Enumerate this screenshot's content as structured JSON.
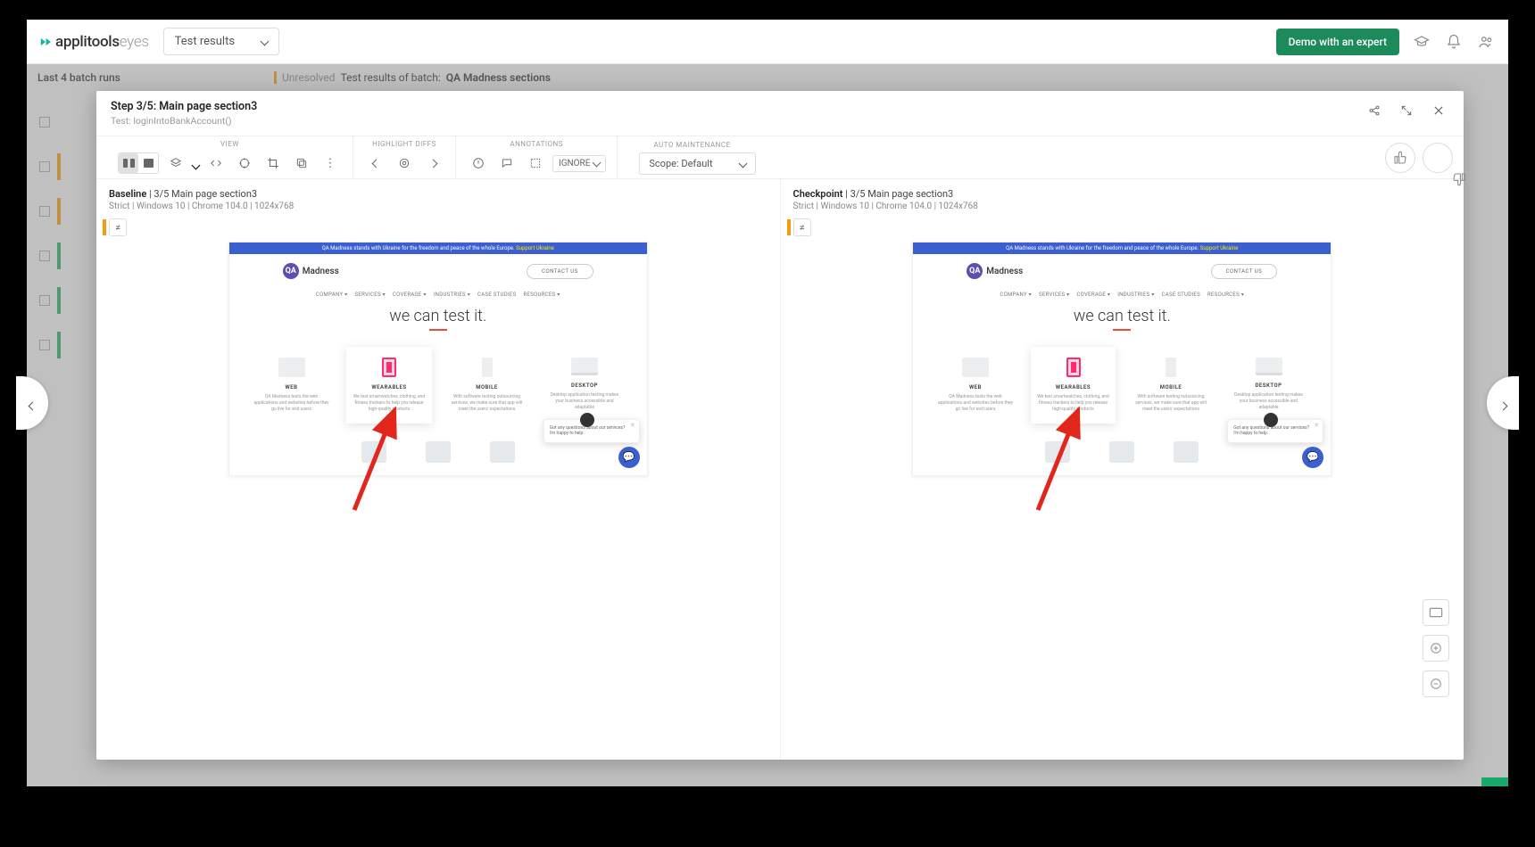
{
  "top_nav": {
    "logo_bold": "applitools",
    "logo_light": "eyes",
    "dropdown": "Test results",
    "demo": "Demo with an expert"
  },
  "background": {
    "batch_list_title": "Last 4 batch runs",
    "status": "Unresolved",
    "results_prefix": "Test results of batch:",
    "batch_name": "QA Madness sections"
  },
  "modal": {
    "title": "Step 3/5:  Main page section3",
    "subtitle": "Test: loginIntoBankAccount()"
  },
  "toolbar": {
    "labels": {
      "view": "VIEW",
      "highlight": "HIGHLIGHT DIFFS",
      "annotations": "ANNOTATIONS",
      "auto": "AUTO MAINTENANCE"
    },
    "ignore": "IGNORE",
    "scope": "Scope: Default"
  },
  "panes": {
    "baseline": {
      "title": "Baseline",
      "crumb": "3/5 Main page section3",
      "meta": "Strict  |  Windows 10  |  Chrome 104.0  |  1024x768"
    },
    "checkpoint": {
      "title": "Checkpoint",
      "crumb": "3/5 Main page section3",
      "meta": "Strict  |  Windows 10  |  Chrome 104.0  |  1024x768"
    }
  },
  "shot": {
    "banner": "QA Madness stands with Ukraine for the freedom and peace of the whole Europe.",
    "banner_link": "Support Ukraine",
    "brand": "Madness",
    "contact": "CONTACT US",
    "nav": [
      "COMPANY ▾",
      "SERVICES ▾",
      "COVERAGE ▾",
      "INDUSTRIES ▾",
      "CASE STUDIES",
      "RESOURCES ▾"
    ],
    "hero": "we can test it.",
    "cards": [
      {
        "t": "WEB",
        "d": "QA Madness tests the web applications and websites before they go live for end users"
      },
      {
        "t": "WEARABLES",
        "d": "We test smartwatches, clothing, and fitness trackers to help you release high-quality products"
      },
      {
        "t": "MOBILE",
        "d": "With software testing outsourcing services, we make sure that app will meet the users' expectations"
      },
      {
        "t": "DESKTOP",
        "d": "Desktop application testing makes your business accessible and adaptable"
      }
    ],
    "chat": "Got any questions about our services? I'm happy to help."
  }
}
